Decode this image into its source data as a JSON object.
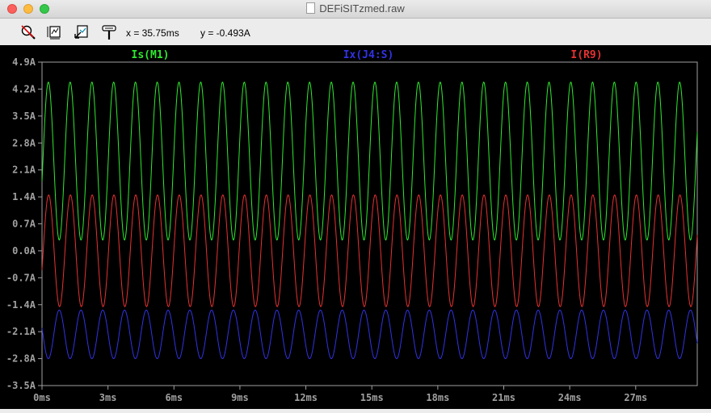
{
  "window": {
    "title": "DEFiSITzmed.raw"
  },
  "toolbar": {
    "icons": [
      "zoom-cancel-icon",
      "zoom-extents-icon",
      "pan-icon",
      "measure-cursor-icon"
    ],
    "x_readout": "x = 35.75ms",
    "y_readout": "y = -0.493A"
  },
  "colors": {
    "background": "#000000",
    "frame": "#a0a0a0",
    "tick_label": "#a0a0a0",
    "is_m1": "#2eea2e",
    "ix_j4s": "#3232e6",
    "i_r9": "#e63232"
  },
  "chart_data": {
    "type": "line",
    "title": "",
    "xlabel": "",
    "ylabel": "",
    "xlim": [
      0,
      29.8
    ],
    "ylim": [
      -3.5,
      4.9
    ],
    "grid": false,
    "x_ticks": [
      "0ms",
      "3ms",
      "6ms",
      "9ms",
      "12ms",
      "15ms",
      "18ms",
      "21ms",
      "24ms",
      "27ms"
    ],
    "x_tick_values": [
      0,
      3,
      6,
      9,
      12,
      15,
      18,
      21,
      24,
      27
    ],
    "y_ticks": [
      "4.9A",
      "4.2A",
      "3.5A",
      "2.8A",
      "2.1A",
      "1.4A",
      "0.7A",
      "0.0A",
      "-0.7A",
      "-1.4A",
      "-2.1A",
      "-2.8A",
      "-3.5A"
    ],
    "y_tick_values": [
      4.9,
      4.2,
      3.5,
      2.8,
      2.1,
      1.4,
      0.7,
      0.0,
      -0.7,
      -1.4,
      -2.1,
      -2.8,
      -3.5
    ],
    "series": [
      {
        "name": "Is(M1)",
        "color": "#2eea2e",
        "waveform": "sine",
        "offset": 2.33,
        "amplitude": 2.05,
        "period_ms": 0.99,
        "phase_deg": -15,
        "x_range": [
          0,
          29.8
        ]
      },
      {
        "name": "Ix(J4:S)",
        "color": "#3232e6",
        "waveform": "sine",
        "offset": -2.17,
        "amplitude": 0.63,
        "period_ms": 0.99,
        "phase_deg": 165,
        "x_range": [
          0,
          29.8
        ]
      },
      {
        "name": "I(R9)",
        "color": "#e63232",
        "waveform": "sine",
        "offset": 0.0,
        "amplitude": 1.45,
        "period_ms": 0.99,
        "phase_deg": -20,
        "x_range": [
          0,
          29.8
        ]
      }
    ]
  }
}
